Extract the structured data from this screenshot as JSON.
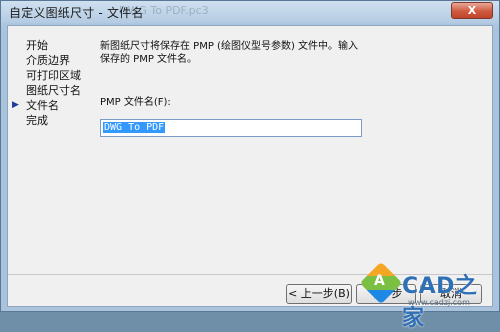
{
  "window": {
    "title": "自定义图纸尺寸 - 文件名",
    "ghost_title": "DWG To PDF.pc3",
    "close_label": "X"
  },
  "sidebar": {
    "active_marker": "▶",
    "items": [
      {
        "label": "开始",
        "active": false
      },
      {
        "label": "介质边界",
        "active": false
      },
      {
        "label": "可打印区域",
        "active": false
      },
      {
        "label": "图纸尺寸名",
        "active": false
      },
      {
        "label": "文件名",
        "active": true
      },
      {
        "label": "完成",
        "active": false
      }
    ]
  },
  "main": {
    "description_line1": "新图纸尺寸将保存在 PMP (绘图仪型号参数) 文件中。输入",
    "description_line2": "保存的 PMP 文件名。",
    "field_label": "PMP 文件名(F):",
    "filename_value": "DWG To PDF"
  },
  "buttons": {
    "back": "< 上一步(B)",
    "next": "下一步",
    "cancel": "取消"
  },
  "watermark": {
    "brand": "CAD之家",
    "cube_letter": "A",
    "url": "www.cadzj.com"
  }
}
